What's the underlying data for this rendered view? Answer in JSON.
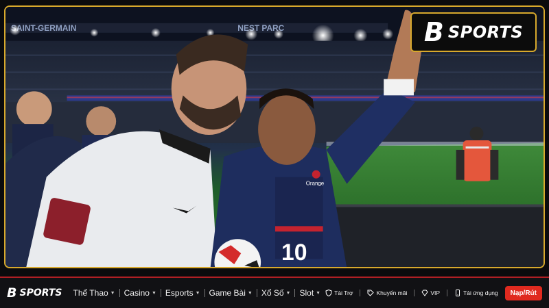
{
  "photo": {
    "stadium_banner": "SAINT-GERMAIN",
    "stadium_banner_2": "NEST PARC",
    "jersey_number": "10",
    "sponsor": "Orange"
  },
  "badge": {
    "mark": "B",
    "text": "SPORTS"
  },
  "nav": {
    "logo_mark": "B",
    "logo_text": "SPORTS",
    "menu": [
      {
        "label": "Thể Thao"
      },
      {
        "label": "Casino"
      },
      {
        "label": "Esports"
      },
      {
        "label": "Game Bài"
      },
      {
        "label": "Xổ Số"
      },
      {
        "label": "Slot"
      }
    ],
    "utilities": [
      {
        "label": "Tài Trợ",
        "icon": "shield-icon"
      },
      {
        "label": "Khuyến mãi",
        "icon": "tag-icon"
      },
      {
        "label": "VIP",
        "icon": "diamond-icon"
      },
      {
        "label": "Tải ứng dụng",
        "icon": "phone-icon"
      }
    ],
    "cta_label": "Nạp/Rút"
  },
  "colors": {
    "accent_gold": "#d8a92c",
    "accent_red": "#e02a1f",
    "navbar_bg": "#111114"
  }
}
